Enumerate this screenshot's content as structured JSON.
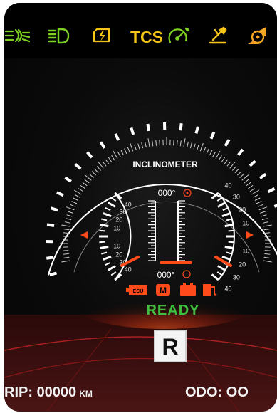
{
  "indicators": {
    "fog_light": {
      "icon": "fog-light-icon",
      "color": "#7ed321",
      "glyph": "≢D≠"
    },
    "headlight": {
      "icon": "low-beam-icon",
      "color": "#7ed321",
      "glyph": "≣D"
    },
    "charging": {
      "icon": "charging-icon",
      "color": "#f5c518",
      "glyph": "⚡"
    },
    "tcs_label": "TCS",
    "tcs_color": "#f5c518",
    "eco": {
      "icon": "eco-speed-icon",
      "color": "#7ed321"
    },
    "service": {
      "icon": "service-wrench-icon",
      "color": "#f5c518"
    },
    "motor": {
      "icon": "motor-warning-icon",
      "color": "#f5a623"
    }
  },
  "gauge": {
    "title": "INCLINOMETER",
    "left_scale": [
      "40",
      "30",
      "20",
      "10",
      "",
      "10",
      "20",
      "30",
      "40"
    ],
    "right_scale": [
      "40",
      "30",
      "20",
      "10",
      "",
      "10",
      "20",
      "30",
      "40"
    ],
    "pitch_readout": "000°",
    "roll_readout": "000°",
    "scale_color": "#ffffff",
    "accent_color": "#ff4a1c"
  },
  "status_icons": [
    {
      "name": "ecu-warning-icon",
      "color": "#ff4a1c"
    },
    {
      "name": "mode-m-icon",
      "color": "#ff4a1c",
      "label": "M"
    },
    {
      "name": "battery-warning-icon",
      "color": "#ff4a1c"
    },
    {
      "name": "fuel-warning-icon",
      "color": "#ff4a1c"
    }
  ],
  "ready_label": "READY",
  "ready_color": "#3fbf3f",
  "gear": "R",
  "trip": {
    "label": "RIP: ",
    "value": "00000",
    "unit": "KM"
  },
  "odo": {
    "label": "ODO: ",
    "value": "OO"
  }
}
